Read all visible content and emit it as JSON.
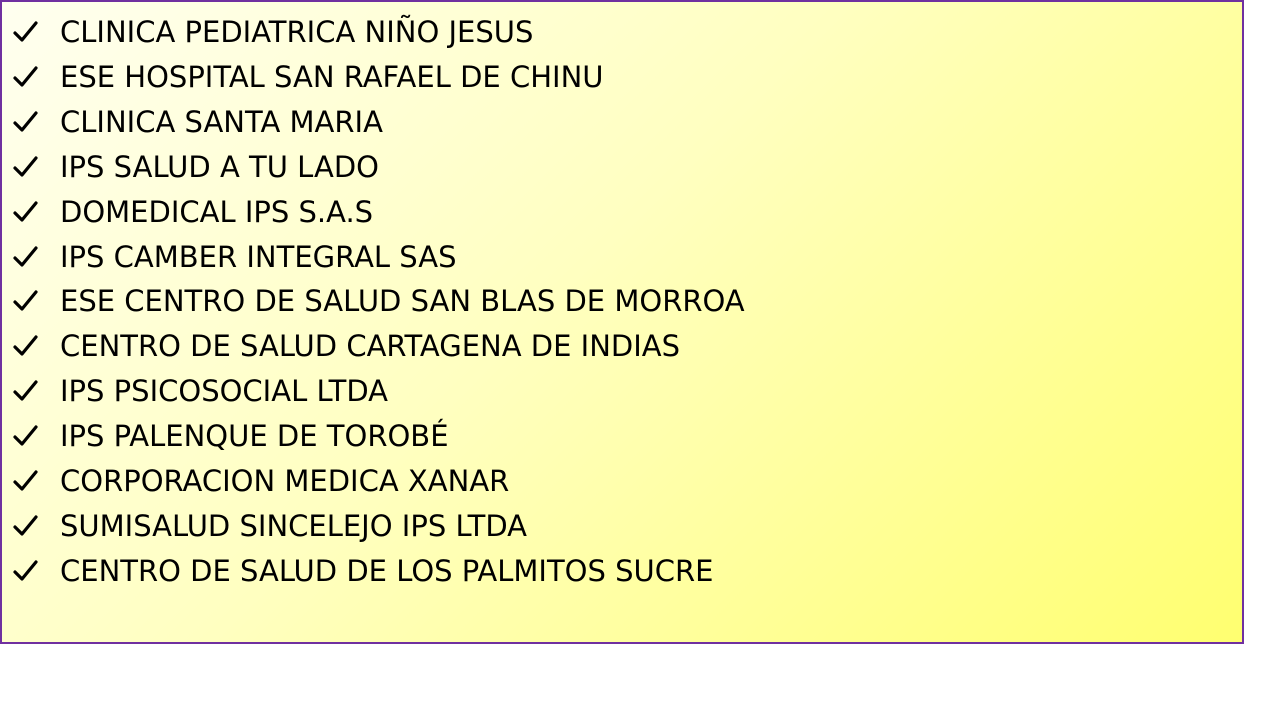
{
  "list": {
    "bullet_icon": "checkmark-icon",
    "border_color": "#7030a0",
    "items": [
      "CLINICA PEDIATRICA NIÑO JESUS",
      "ESE HOSPITAL SAN RAFAEL DE CHINU",
      "CLINICA SANTA MARIA",
      "IPS SALUD A TU LADO",
      "DOMEDICAL IPS S.A.S",
      "IPS CAMBER INTEGRAL SAS",
      "ESE CENTRO DE SALUD SAN BLAS DE MORROA",
      "CENTRO DE SALUD CARTAGENA DE INDIAS",
      "IPS PSICOSOCIAL LTDA",
      "IPS PALENQUE DE TOROBÉ",
      "CORPORACION MEDICA XANAR",
      "SUMISALUD SINCELEJO IPS LTDA",
      "CENTRO DE SALUD DE LOS PALMITOS SUCRE"
    ]
  }
}
